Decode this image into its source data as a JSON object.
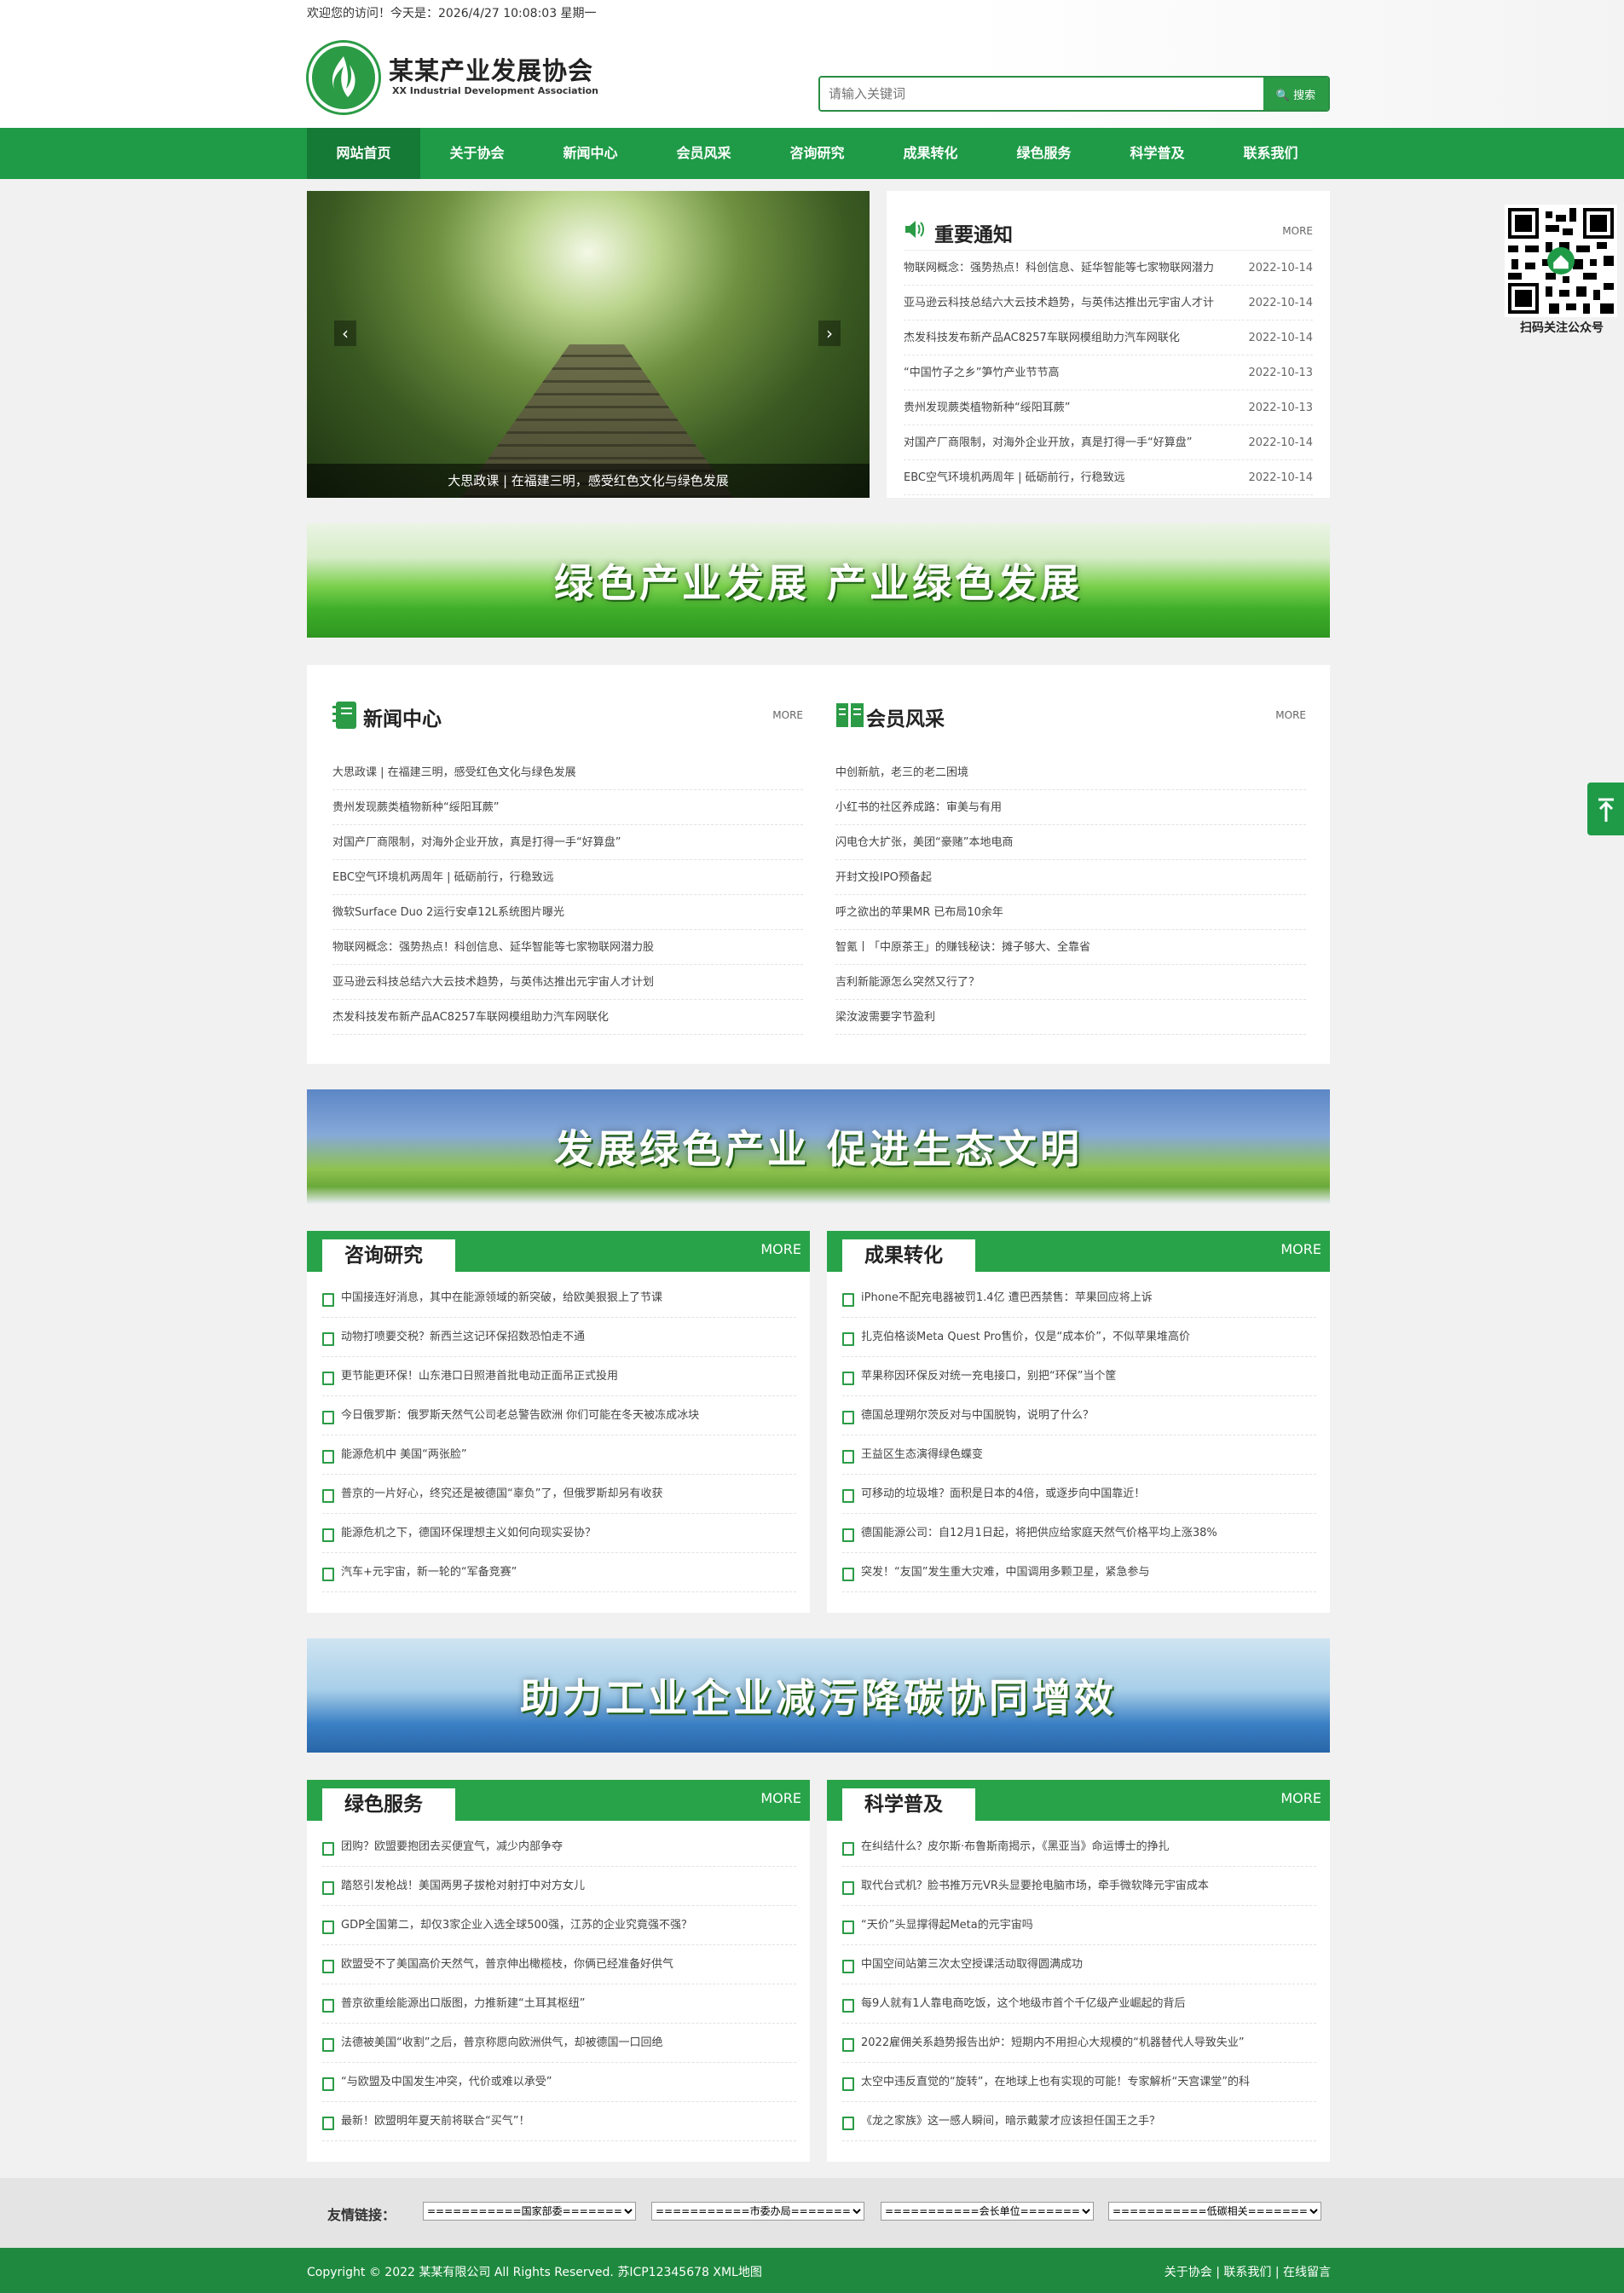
{
  "header": {
    "welcome": "欢迎您的访问！今天是：2026/4/27 10:08:03 星期一",
    "site_name": "某某产业发展协会",
    "site_name_en": "XX Industrial Development Association",
    "search_placeholder": "请输入关键词",
    "search_button": "搜索"
  },
  "nav": [
    "网站首页",
    "关于协会",
    "新闻中心",
    "会员风采",
    "咨询研究",
    "成果转化",
    "绿色服务",
    "科学普及",
    "联系我们"
  ],
  "slider": {
    "caption": "大思政课 | 在福建三明，感受红色文化与绿色发展"
  },
  "notice": {
    "title": "重要通知",
    "more": "MORE",
    "items": [
      {
        "text": "物联网概念：强势热点！科创信息、延华智能等七家物联网潜力",
        "date": "2022-10-14"
      },
      {
        "text": "亚马逊云科技总结六大云技术趋势，与英伟达推出元宇宙人才计",
        "date": "2022-10-14"
      },
      {
        "text": "杰发科技发布新产品AC8257车联网模组助力汽车网联化",
        "date": "2022-10-14"
      },
      {
        "text": "“中国竹子之乡”笋竹产业节节高",
        "date": "2022-10-13"
      },
      {
        "text": "贵州发现蕨类植物新种“绥阳耳蕨”",
        "date": "2022-10-13"
      },
      {
        "text": "对国产厂商限制，对海外企业开放，真是打得一手“好算盘”",
        "date": "2022-10-14"
      },
      {
        "text": "EBC空气环境机两周年 | 砥砺前行，行稳致远",
        "date": "2022-10-14"
      }
    ]
  },
  "banners": [
    "绿色产业发展 产业绿色发展",
    "发展绿色产业 促进生态文明",
    "助力工业企业减污降碳协同增效"
  ],
  "news": {
    "title": "新闻中心",
    "more": "MORE",
    "items": [
      "大思政课 | 在福建三明，感受红色文化与绿色发展",
      "贵州发现蕨类植物新种“绥阳耳蕨”",
      "对国产厂商限制，对海外企业开放，真是打得一手“好算盘”",
      "EBC空气环境机两周年 | 砥砺前行，行稳致远",
      "微软Surface Duo 2运行安卓12L系统图片曝光",
      "物联网概念：强势热点！科创信息、延华智能等七家物联网潜力股",
      "亚马逊云科技总结六大云技术趋势，与英伟达推出元宇宙人才计划",
      "杰发科技发布新产品AC8257车联网模组助力汽车网联化"
    ]
  },
  "members": {
    "title": "会员风采",
    "more": "MORE",
    "items": [
      "中创新航，老三的老二困境",
      "小红书的社区养成路：审美与有用",
      "闪电仓大扩张，美团“豪赌”本地电商",
      "开封文投IPO预备起",
      "呼之欲出的苹果MR 已布局10余年",
      "智氪丨「中原茶王」的赚钱秘诀：摊子够大、全靠省",
      "吉利新能源怎么突然又行了？",
      "梁汝波需要字节盈利"
    ]
  },
  "consult": {
    "title": "咨询研究",
    "more": "MORE",
    "items": [
      "中国接连好消息，其中在能源领域的新突破，给欧美狠狠上了节课",
      "动物打喷要交税？新西兰这记环保招数恐怕走不通",
      "更节能更环保！山东港口日照港首批电动正面吊正式投用",
      "今日俄罗斯：俄罗斯天然气公司老总警告欧洲 你们可能在冬天被冻成冰块",
      "能源危机中 美国“两张脸”",
      "普京的一片好心，终究还是被德国“辜负”了，但俄罗斯却另有收获",
      "能源危机之下，德国环保理想主义如何向现实妥协？",
      "汽车+元宇宙，新一轮的“军备竞赛”"
    ]
  },
  "results": {
    "title": "成果转化",
    "more": "MORE",
    "items": [
      "iPhone不配充电器被罚1.4亿 遭巴西禁售：苹果回应将上诉",
      "扎克伯格谈Meta Quest Pro售价，仅是“成本价”，不似苹果堆高价",
      "苹果称因环保反对统一充电接口，别把“环保”当个筐",
      "德国总理朔尔茨反对与中国脱钩，说明了什么？",
      "王益区生态演得绿色蝶变",
      "可移动的垃圾堆？面积是日本的4倍，或逐步向中国靠近！",
      "德国能源公司：自12月1日起，将把供应给家庭天然气价格平均上涨38%",
      "突发！“友国”发生重大灾难，中国调用多颗卫星，紧急参与"
    ]
  },
  "green": {
    "title": "绿色服务",
    "more": "MORE",
    "items": [
      "团购？欧盟要抱团去买便宜气，减少内部争夺",
      "踏怒引发枪战！美国两男子拔枪对射打中对方女儿",
      "GDP全国第二，却仅3家企业入选全球500强，江苏的企业究竟强不强？",
      "欧盟受不了美国高价天然气，普京伸出橄榄枝，你俩已经准备好供气",
      "普京欲重绘能源出口版图，力推新建“土耳其枢纽”",
      "法德被美国“收割”之后，普京称愿向欧洲供气，却被德国一口回绝",
      "“与欧盟及中国发生冲突，代价或难以承受”",
      "最新！欧盟明年夏天前将联合“买气”！"
    ]
  },
  "science": {
    "title": "科学普及",
    "more": "MORE",
    "items": [
      "在纠结什么？皮尔斯·布鲁斯南揭示，《黑亚当》命运博士的挣扎",
      "取代台式机？脸书推万元VR头显要抢电脑市场，牵手微软降元宇宙成本",
      "“天价”头显撑得起Meta的元宇宙吗",
      "中国空间站第三次太空授课活动取得圆满成功",
      "每9人就有1人靠电商吃饭，这个地级市首个千亿级产业崛起的背后",
      "2022雇佣关系趋势报告出炉：短期内不用担心大规模的“机器替代人导致失业”",
      "太空中违反直觉的“旋转”，在地球上也有实现的可能！专家解析“天宫课堂”的科",
      "《龙之家族》这一感人瞬间，暗示戴蒙才应该担任国王之手？"
    ]
  },
  "qr": {
    "caption": "扫码关注公众号"
  },
  "friend_links": {
    "label": "友情链接：",
    "selects": [
      "===========国家部委===========",
      "===========市委办局===========",
      "===========会长单位===========",
      "===========低碳相关==========="
    ]
  },
  "footer": {
    "copyright": "Copyright © 2022 某某有限公司 All Rights Reserved. 苏ICP12345678  XML地图",
    "links": "关于协会 | 联系我们 | 在线留言"
  },
  "colors": {
    "primary": "#1f9b48",
    "dark": "#157a36"
  }
}
